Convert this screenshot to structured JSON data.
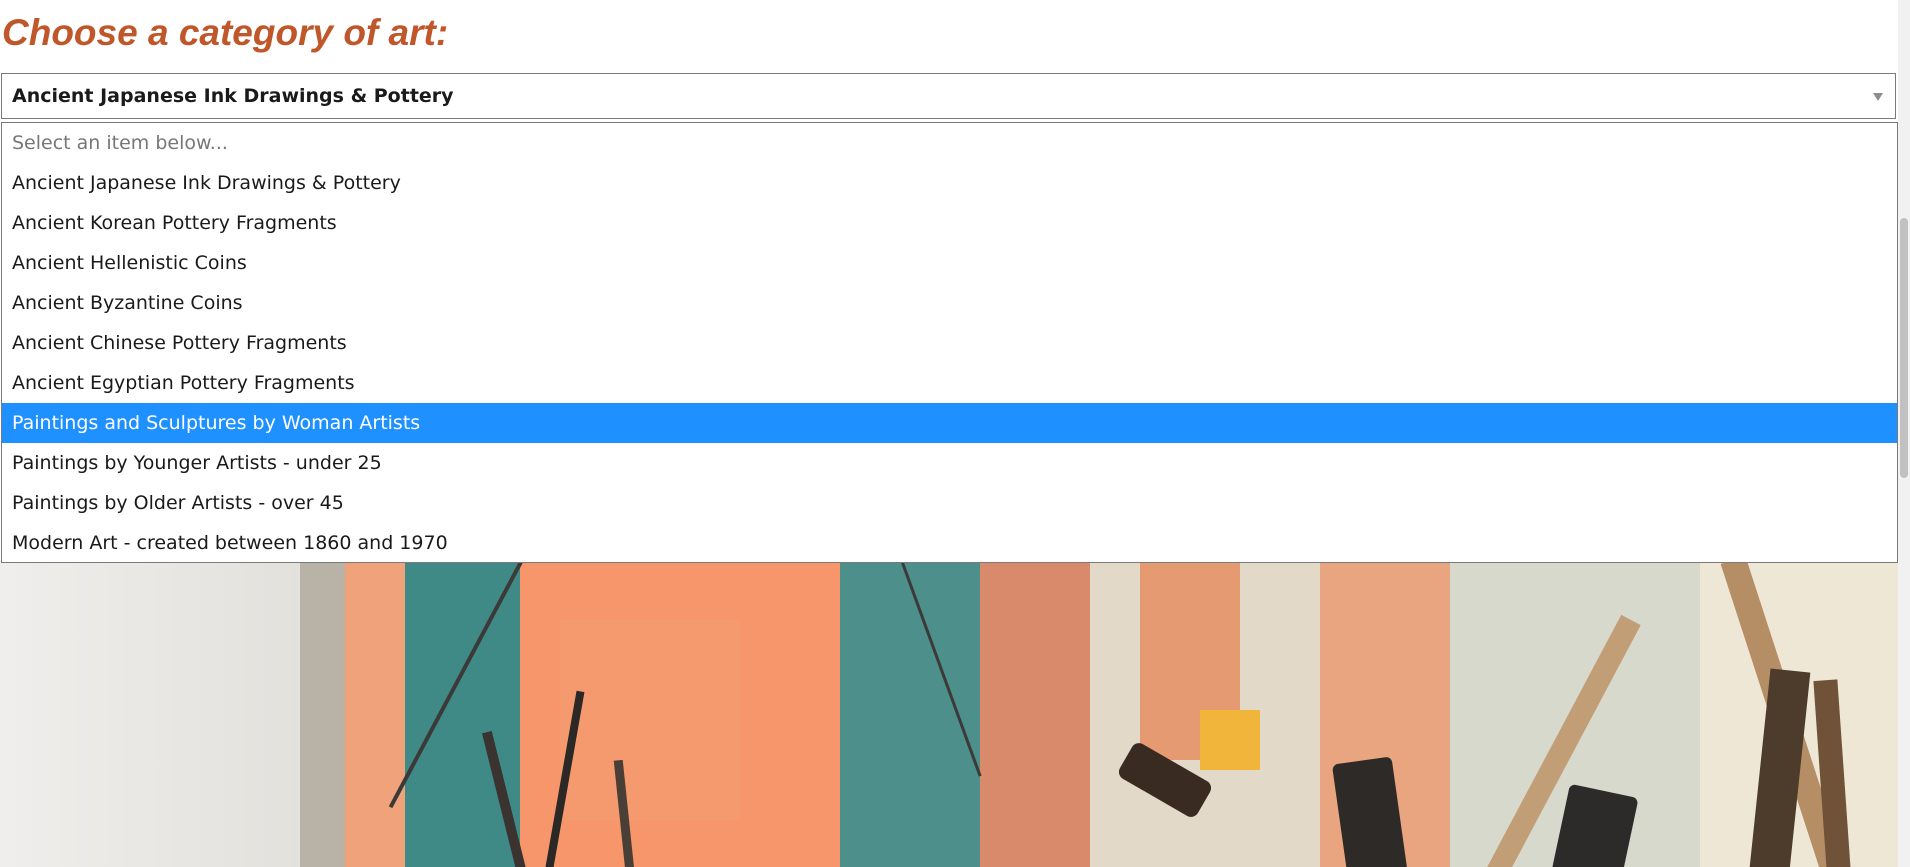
{
  "page": {
    "heading": "Choose a category of art:"
  },
  "category_select": {
    "selected_value": "Ancient Japanese Ink Drawings & Pottery",
    "icon": "chevron-down-icon",
    "options": [
      {
        "label": "Select an item below...",
        "placeholder": true,
        "highlighted": false
      },
      {
        "label": "Ancient Japanese Ink Drawings & Pottery",
        "placeholder": false,
        "highlighted": false
      },
      {
        "label": "Ancient Korean Pottery Fragments",
        "placeholder": false,
        "highlighted": false
      },
      {
        "label": "Ancient Hellenistic Coins",
        "placeholder": false,
        "highlighted": false
      },
      {
        "label": "Ancient Byzantine Coins",
        "placeholder": false,
        "highlighted": false
      },
      {
        "label": "Ancient Chinese Pottery Fragments",
        "placeholder": false,
        "highlighted": false
      },
      {
        "label": "Ancient Egyptian Pottery Fragments",
        "placeholder": false,
        "highlighted": false
      },
      {
        "label": "Paintings and Sculptures by Woman Artists",
        "placeholder": false,
        "highlighted": true
      },
      {
        "label": "Paintings by Younger Artists - under 25",
        "placeholder": false,
        "highlighted": false
      },
      {
        "label": "Paintings by Older Artists - over 45",
        "placeholder": false,
        "highlighted": false
      },
      {
        "label": "Modern Art - created between 1860 and 1970",
        "placeholder": false,
        "highlighted": false
      }
    ]
  },
  "colors": {
    "heading": "#c0572a",
    "highlight": "#1e90ff"
  }
}
